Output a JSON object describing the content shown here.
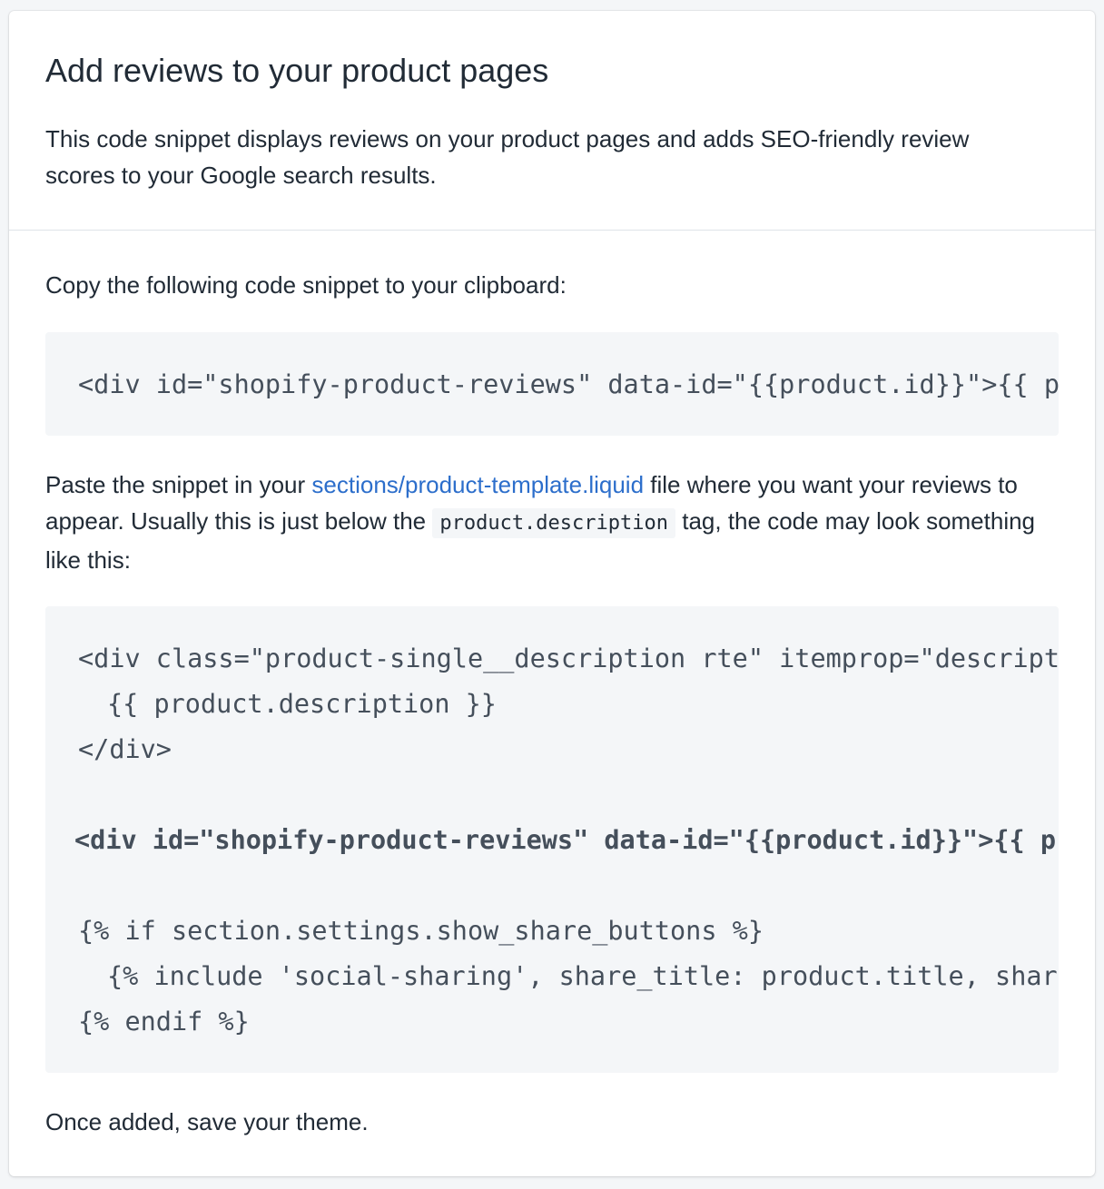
{
  "card": {
    "title": "Add reviews to your product pages",
    "intro": "This code snippet displays reviews on your product pages and adds SEO-friendly review scores to your Google search results."
  },
  "instructions": {
    "copy_label": "Copy the following code snippet to your clipboard:",
    "snippet": "<div id=\"shopify-product-reviews\" data-id=\"{{product.id}}\">{{ p",
    "paste_prefix": "Paste the snippet in your ",
    "paste_link": "sections/product-template.liquid",
    "paste_middle": " file where you want your reviews to appear. Usually this is just below the ",
    "paste_inline_code": "product.description",
    "paste_suffix": " tag, the code may look something like this:",
    "example_lines": [
      "<div class=\"product-single__description rte\" itemprop=\"descript",
      "{{ product.description }}",
      "</div>",
      "<div id=\"shopify-product-reviews\" data-id=\"{{product.id}}\">{{ p",
      "{% if section.settings.show_share_buttons %}",
      "{% include 'social-sharing', share_title: product.title, shar",
      "{% endif %}"
    ],
    "outro": "Once added, save your theme."
  }
}
